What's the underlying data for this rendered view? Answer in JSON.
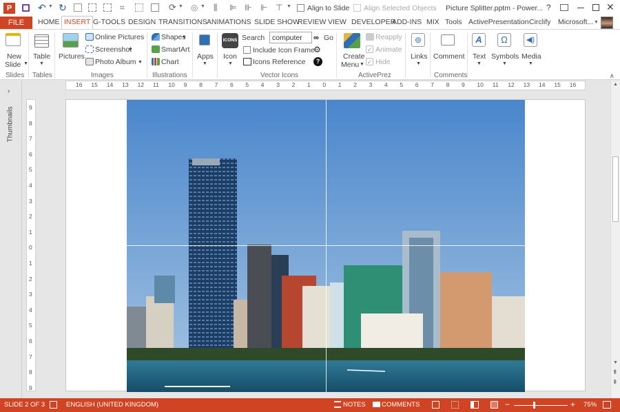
{
  "title": {
    "window_title": "Picture Splitter.pptm - Power...",
    "align_to_slide": "Align to Slide",
    "align_selected": "Align Selected Objects",
    "help": "?",
    "app_initial": "P"
  },
  "tabs": {
    "file": "FILE",
    "items": [
      "HOME",
      "INSERT",
      "G-TOOLS",
      "DESIGN",
      "TRANSITIONS",
      "ANIMATIONS",
      "SLIDE SHOW",
      "REVIEW",
      "VIEW",
      "DEVELOPER",
      "ADD-INS",
      "MIX",
      "Tools",
      "ActivePresentation",
      "Circlify"
    ],
    "account": "Microsoft..."
  },
  "ribbon": {
    "new_slide": "New",
    "new_slide2": "Slide",
    "table": "Table",
    "pictures": "Pictures",
    "online_pictures": "Online Pictures",
    "screenshot": "Screenshot",
    "photo_album": "Photo Album",
    "shapes": "Shapes",
    "smartart": "SmartArt",
    "chart": "Chart",
    "apps": "Apps",
    "icon": "Icon",
    "search_label": "Search",
    "search_value": "computer",
    "go": "Go",
    "include_frame": "Include Icon Frame",
    "icons_reference": "Icons Reference",
    "create_menu": "Create",
    "create_menu2": "Menu",
    "reapply": "Reapply",
    "animate": "Animate",
    "hide": "Hide",
    "links": "Links",
    "comment": "Comment",
    "text": "Text",
    "symbols": "Symbols",
    "media": "Media",
    "icons_badge": "ICONS",
    "groups": {
      "slides": "Slides",
      "tables": "Tables",
      "images": "Images",
      "illustrations": "Illustrations",
      "vector_icons": "Vector Icons",
      "activeprez": "ActivePrez",
      "comments": "Comments"
    }
  },
  "ruler_h": [
    "16",
    "15",
    "14",
    "13",
    "12",
    "11",
    "10",
    "9",
    "8",
    "7",
    "6",
    "5",
    "4",
    "3",
    "2",
    "1",
    "0",
    "1",
    "2",
    "3",
    "4",
    "5",
    "6",
    "7",
    "8",
    "9",
    "10",
    "11",
    "12",
    "13",
    "14",
    "15",
    "16"
  ],
  "ruler_v": [
    "9",
    "8",
    "7",
    "6",
    "5",
    "4",
    "3",
    "2",
    "1",
    "0",
    "1",
    "2",
    "3",
    "4",
    "5",
    "6",
    "7",
    "8",
    "9"
  ],
  "thumbnails_label": "Thumbnails",
  "status": {
    "slide": "SLIDE 2 OF 3",
    "language": "ENGLISH (UNITED KINGDOM)",
    "notes": "NOTES",
    "comments": "COMMENTS",
    "zoom": "75%"
  },
  "colors": {
    "accent": "#d04423",
    "sky": "#5a8fcf",
    "water": "#1f5f7c"
  }
}
